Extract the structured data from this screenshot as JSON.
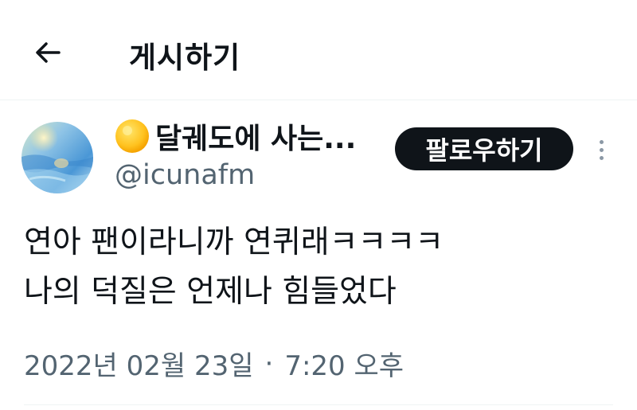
{
  "header": {
    "back_icon": "arrow-left-icon",
    "title": "게시하기"
  },
  "author": {
    "avatar_icon": "profile-avatar-watercolor",
    "name_emoji_icon": "sun-icon",
    "display_name": "달궤도에 사는...",
    "handle": "@icunafm"
  },
  "actions": {
    "follow_label": "팔로우하기",
    "more_icon": "more-vertical-icon"
  },
  "tweet": {
    "lines": [
      "연아 팬이라니까 연퀴래ㅋㅋㅋㅋ",
      "나의 덕질은 언제나 힘들었다"
    ],
    "date": "2022년 02월 23일",
    "separator": "·",
    "time": "7:20 오후"
  },
  "colors": {
    "text_primary": "#0f1419",
    "text_secondary": "#536471",
    "follow_bg": "#0f1419",
    "follow_text": "#ffffff",
    "divider": "#eff3f4"
  }
}
